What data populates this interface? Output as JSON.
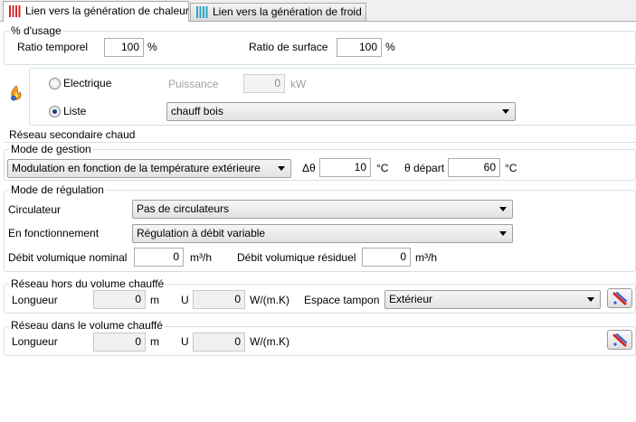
{
  "tabs": [
    {
      "label": "Lien vers la génération de chaleur",
      "active": true
    },
    {
      "label": "Lien vers la génération de froid",
      "active": false
    }
  ],
  "usage": {
    "title": "% d'usage",
    "ratio_temporel_label": "Ratio temporel",
    "ratio_temporel_value": "100",
    "ratio_temporel_unit": "%",
    "ratio_surface_label": "Ratio de surface",
    "ratio_surface_value": "100",
    "ratio_surface_unit": "%"
  },
  "generation": {
    "electrique_label": "Electrique",
    "puissance_label": "Puissance",
    "puissance_value": "0",
    "puissance_unit": "kW",
    "liste_label": "Liste",
    "liste_value": "chauff bois",
    "selected": "liste"
  },
  "reseau": {
    "title": "Réseau secondaire chaud",
    "mode_gestion": {
      "title": "Mode de gestion",
      "value": "Modulation en fonction de la température extérieure",
      "delta_label": "Δθ",
      "delta_value": "10",
      "delta_unit": "°C",
      "depart_label": "θ départ",
      "depart_value": "60",
      "depart_unit": "°C"
    },
    "mode_regulation": {
      "title": "Mode de régulation",
      "circulateur_label": "Circulateur",
      "circulateur_value": "Pas de circulateurs",
      "fonctionnement_label": "En fonctionnement",
      "fonctionnement_value": "Régulation à débit variable",
      "debit_nominal_label": "Débit volumique nominal",
      "debit_nominal_value": "0",
      "debit_nominal_unit": "m³/h",
      "debit_residuel_label": "Débit volumique résiduel",
      "debit_residuel_value": "0",
      "debit_residuel_unit": "m³/h"
    },
    "hors_volume": {
      "title": "Réseau hors du volume chauffé",
      "longueur_label": "Longueur",
      "longueur_value": "0",
      "longueur_unit": "m",
      "u_label": "U",
      "u_value": "0",
      "u_unit": "W/(m.K)",
      "espace_label": "Espace tampon",
      "espace_value": "Extérieur"
    },
    "dans_volume": {
      "title": "Réseau dans le volume chauffé",
      "longueur_label": "Longueur",
      "longueur_value": "0",
      "longueur_unit": "m",
      "u_label": "U",
      "u_value": "0",
      "u_unit": "W/(m.K)"
    }
  },
  "colors": {
    "heat_accent": "#d42a2a",
    "cold_accent": "#2aa6c9",
    "radio_dot": "#1e3f78",
    "group_border": "#d5dfe5"
  },
  "icons": [
    "radiator-heat-icon",
    "radiator-cold-icon",
    "flame-icon",
    "pipe-edit-icon"
  ]
}
